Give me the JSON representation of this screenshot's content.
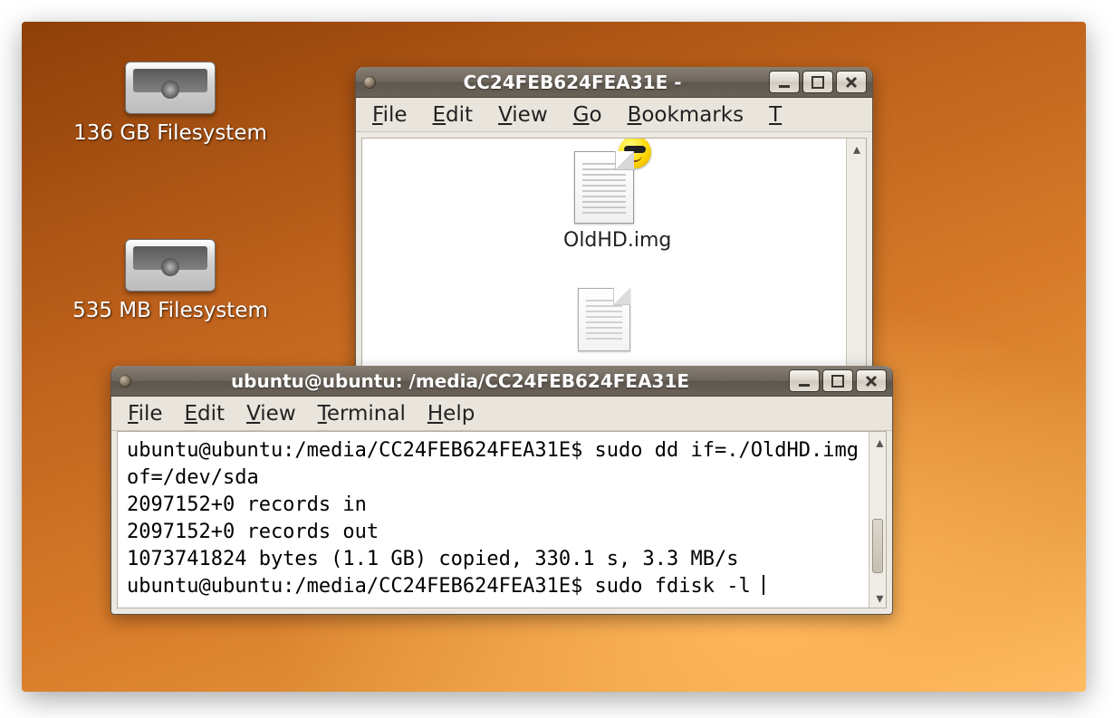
{
  "desktop_icons": [
    {
      "label": "136 GB Filesystem"
    },
    {
      "label": "535 MB Filesystem"
    }
  ],
  "file_manager": {
    "title": "CC24FEB624FEA31E -",
    "menus": {
      "file": {
        "u": "F",
        "rest": "ile"
      },
      "edit": {
        "u": "E",
        "rest": "dit"
      },
      "view": {
        "u": "V",
        "rest": "iew"
      },
      "go": {
        "u": "G",
        "rest": "o"
      },
      "bookmarks": {
        "u": "B",
        "rest": "ookmarks"
      },
      "last": {
        "u": "T",
        "rest": ""
      }
    },
    "files": [
      {
        "name": "OldHD.img"
      }
    ]
  },
  "terminal": {
    "title": "ubuntu@ubuntu: /media/CC24FEB624FEA31E",
    "menus": {
      "file": {
        "u": "F",
        "rest": "ile"
      },
      "edit": {
        "u": "E",
        "rest": "dit"
      },
      "view": {
        "u": "V",
        "rest": "iew"
      },
      "terminal": {
        "u": "T",
        "rest": "erminal"
      },
      "help": {
        "u": "H",
        "rest": "elp"
      }
    },
    "lines": [
      "ubuntu@ubuntu:/media/CC24FEB624FEA31E$ sudo dd if=./OldHD.img of=/dev/sda",
      "2097152+0 records in",
      "2097152+0 records out",
      "1073741824 bytes (1.1 GB) copied, 330.1 s, 3.3 MB/s",
      "ubuntu@ubuntu:/media/CC24FEB624FEA31E$ sudo fdisk -l"
    ]
  }
}
